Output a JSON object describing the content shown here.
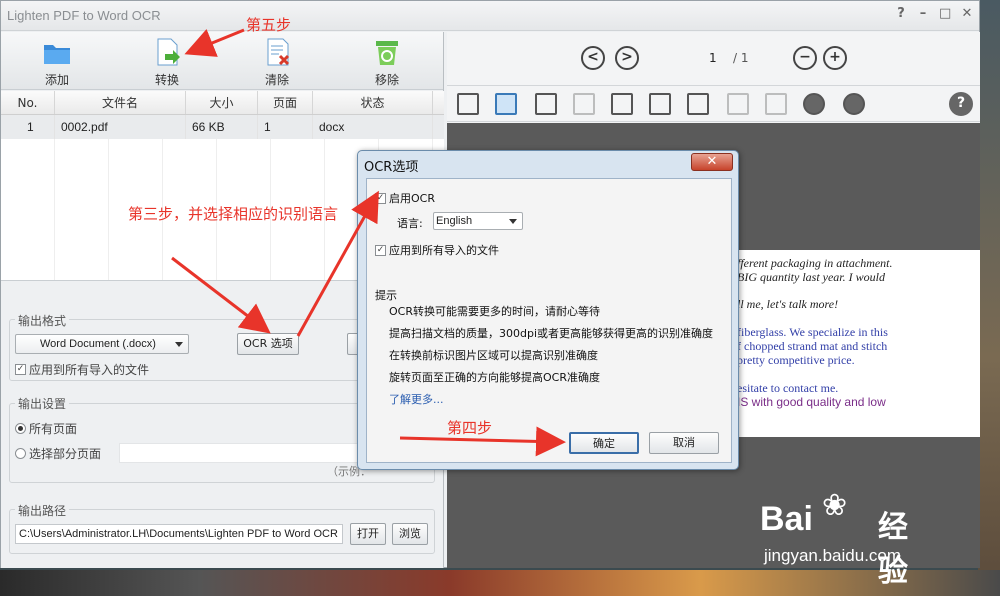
{
  "window": {
    "title": "Lighten PDF to Word OCR",
    "controls": [
      "?",
      "–",
      "□",
      "✕"
    ]
  },
  "toolbar": {
    "add": {
      "label": "添加",
      "icon": "folder-open-icon"
    },
    "convert": {
      "label": "转换",
      "icon": "convert-doc-icon"
    },
    "clear": {
      "label": "清除",
      "icon": "clear-doc-icon"
    },
    "remove": {
      "label": "移除",
      "icon": "recycle-bin-icon"
    }
  },
  "table": {
    "headers": [
      "No.",
      "文件名",
      "大小",
      "页面",
      "状态"
    ],
    "rows": [
      {
        "no": "1",
        "name": "0002.pdf",
        "size": "66 KB",
        "pages": "1",
        "status": "docx"
      }
    ]
  },
  "output_format": {
    "title": "输出格式",
    "format_value": "Word Document (.docx)",
    "ocr_button": "OCR 选项",
    "apply_all": "应用到所有导入的文件"
  },
  "output_settings": {
    "title": "输出设置",
    "all_pages": "所有页面",
    "select_pages": "选择部分页面",
    "example": "（示例："
  },
  "output_path": {
    "title": "输出路径",
    "value": "C:\\Users\\Administrator.LH\\Documents\\Lighten PDF to Word OCR",
    "open": "打开",
    "browse": "浏览"
  },
  "viewer": {
    "page_current": "1",
    "page_total": "/ 1",
    "prev": "<",
    "next": ">",
    "zoom_out": "−",
    "zoom_in": "+",
    "help": "?",
    "page_lines": [
      "fferent packaging in attachment.",
      "BIG quantity last year. I would",
      "ll me, let's talk more!",
      "fiberglass. We specialize in this",
      "f chopped strand mat and stitch",
      "pretty competitive price.",
      "esitate to contact me.",
      "IS with good quality and low"
    ]
  },
  "dialog": {
    "title": "OCR选项",
    "close": "✕",
    "enable_ocr": "启用OCR",
    "language_label": "语言:",
    "language_value": "English",
    "apply_all": "应用到所有导入的文件",
    "tips_title": "提示",
    "tips": [
      "OCR转换可能需要更多的时间，请耐心等待",
      "提高扫描文档的质量，300dpi或者更高能够获得更高的识别准确度",
      "在转换前标识图片区域可以提高识别准确度",
      "旋转页面至正确的方向能够提高OCR准确度"
    ],
    "learn_more": "了解更多...",
    "ok": "确定",
    "cancel": "取消"
  },
  "annotations": {
    "step5": "第五步",
    "step3": "第三步，并选择相应的识别语言",
    "step4": "第四步"
  },
  "watermark": {
    "brand": "Bai",
    "brand2": "经验",
    "url": "jingyan.baidu.com"
  }
}
